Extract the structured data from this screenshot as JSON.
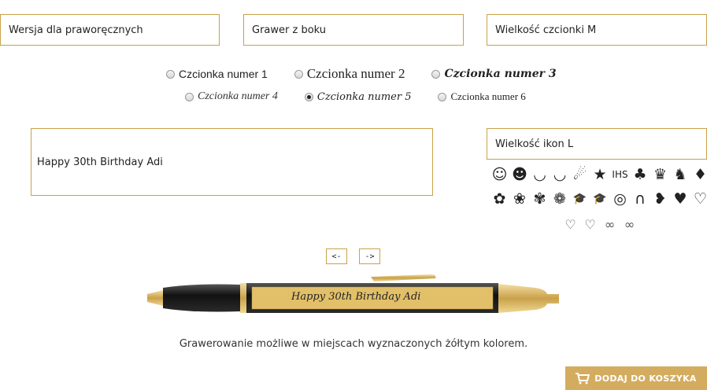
{
  "selects": {
    "hand": "Wersja dla praworęcznych",
    "engrave": "Grawer z boku",
    "font_size": "Wielkość czcionki M",
    "icon_size": "Wielkość ikon L"
  },
  "fonts": [
    {
      "label": "Czcionka numer 1",
      "checked": false
    },
    {
      "label": "Czcionka numer 2",
      "checked": false
    },
    {
      "label": "Czcionka numer 3",
      "checked": false
    },
    {
      "label": "Czcionka numer 4",
      "checked": false
    },
    {
      "label": "Czcionka numer 5",
      "checked": true
    },
    {
      "label": "Czcionka numer 6",
      "checked": false
    }
  ],
  "engraving_text": "Happy 30th Birthday Adi",
  "icons_row1": [
    "☺",
    "☻",
    "◡",
    "◡",
    "☄",
    "★",
    "IHS",
    "♣",
    "♛",
    "♞",
    "♦"
  ],
  "icons_row2": [
    "✿",
    "❀",
    "✾",
    "❁",
    "🎓",
    "🎓",
    "◎",
    "∩",
    "❥",
    "♥",
    "♡"
  ],
  "icons_row3": [
    "♡",
    "♡",
    "∞",
    "∞"
  ],
  "nav": {
    "prev": "<-",
    "next": "->"
  },
  "pen_text": "Happy 30th Birthday Adi",
  "caption": "Grawerowanie możliwe w miejscach wyznaczonych żółtym kolorem.",
  "cart_label": "DODAJ DO KOSZYKA",
  "colors": {
    "accent": "#c9a14a",
    "button": "#d4ac5f",
    "pen_body": "#1a1a1a",
    "gold": "#e2c06a"
  }
}
